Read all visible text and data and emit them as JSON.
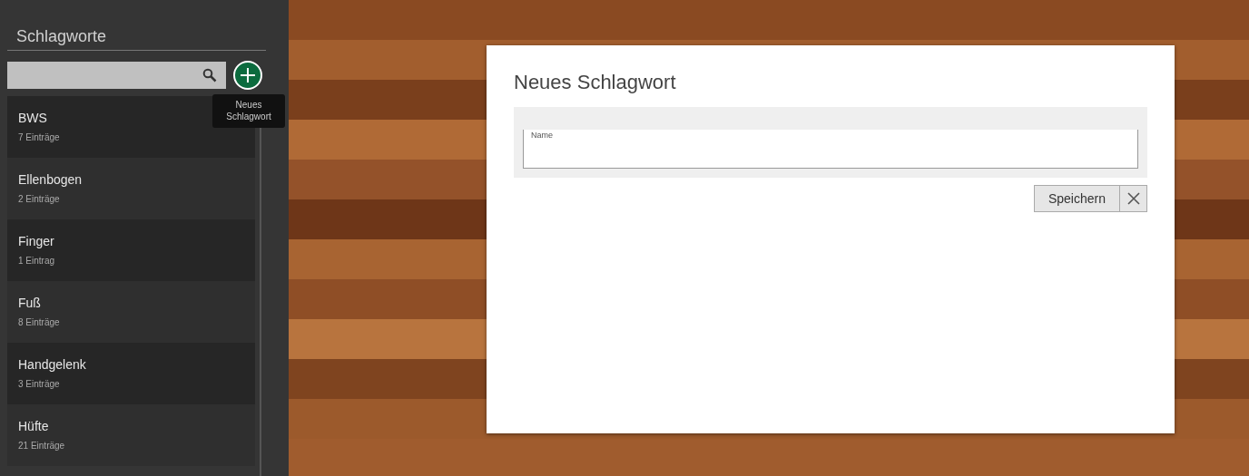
{
  "sidebar": {
    "title": "Schlagworte",
    "add_button": {
      "tooltip": "Neues Schlagwort"
    },
    "items": [
      {
        "name": "BWS",
        "count": "7 Einträge"
      },
      {
        "name": "Ellenbogen",
        "count": "2 Einträge"
      },
      {
        "name": "Finger",
        "count": "1 Eintrag"
      },
      {
        "name": "Fuß",
        "count": "8 Einträge"
      },
      {
        "name": "Handgelenk",
        "count": "3 Einträge"
      },
      {
        "name": "Hüfte",
        "count": "21 Einträge"
      }
    ]
  },
  "dialog": {
    "title": "Neues Schlagwort",
    "field": {
      "label": "Name"
    },
    "buttons": [
      "Speichern"
    ]
  }
}
